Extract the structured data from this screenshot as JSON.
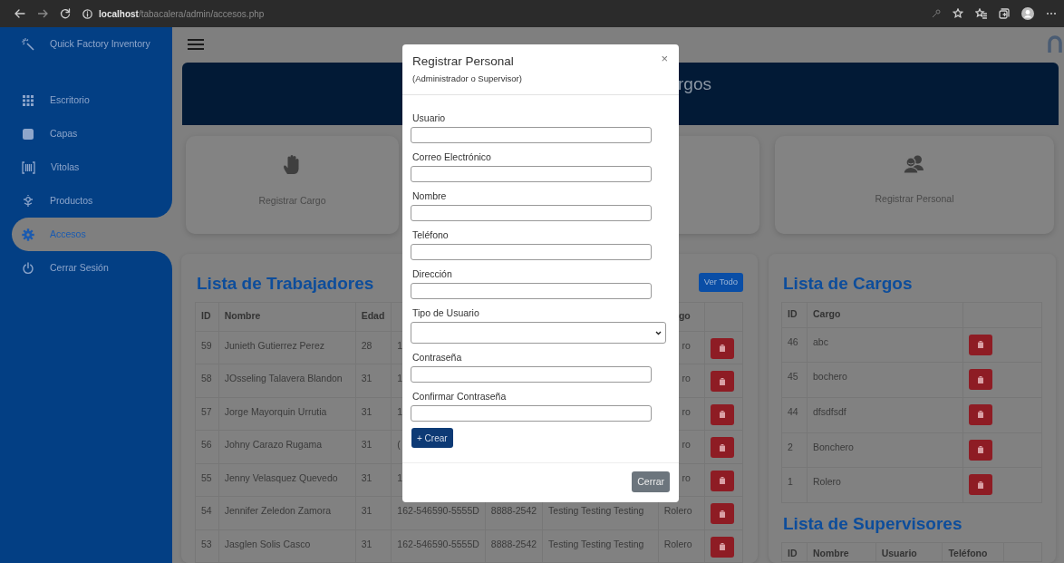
{
  "browser": {
    "url": "**localhost**/tabacalera/admin/accesos.php"
  },
  "sidebar": {
    "brand": "Quick Factory Inventory",
    "items": [
      {
        "label": "Escritorio",
        "selected": false
      },
      {
        "label": "Capas",
        "selected": false
      },
      {
        "label": "Vitolas",
        "selected": false
      },
      {
        "label": "Productos",
        "selected": false
      },
      {
        "label": "Accesos",
        "selected": true
      },
      {
        "label": "Cerrar Sesión",
        "selected": false
      }
    ]
  },
  "banner": {
    "title": "rgos"
  },
  "action_cards": [
    {
      "kind": "action",
      "label": "Registrar Cargo"
    },
    {
      "kind": "covered"
    },
    {
      "kind": "action",
      "label": "Registrar Personal"
    }
  ],
  "workers": {
    "title": "Lista de Trabajadores",
    "button": "Ver Todo",
    "columns": [
      "ID",
      "Nombre",
      "Edad",
      null,
      null,
      null,
      "go"
    ],
    "rows": [
      {
        "cells": [
          "59",
          "Junieth Gutierrez Perez",
          "28",
          "1",
          null,
          null,
          "ro"
        ]
      },
      {
        "cells": [
          "58",
          "JOsseling Talavera Blandon",
          "31",
          "1",
          null,
          null,
          "ro"
        ]
      },
      {
        "cells": [
          "57",
          "Jorge Mayorquin Urrutia",
          "31",
          "1",
          null,
          null,
          "ro"
        ]
      },
      {
        "cells": [
          "56",
          "Johny Carazo Rugama",
          "31",
          "(",
          null,
          null,
          "ro"
        ]
      },
      {
        "cells": [
          "55",
          "Jenny Velasquez Quevedo",
          "31",
          "1",
          null,
          null,
          "ro"
        ]
      },
      {
        "cells": [
          "54",
          "Jennifer Zeledon Zamora",
          "31",
          "162-546590-5555D",
          "8888-2542",
          "Testing Testing Testing",
          "Rolero"
        ]
      },
      {
        "cells": [
          "53",
          "Jasglen Solis Casco",
          "31",
          "162-546590-5555D",
          "8888-2542",
          "Testing Testing Testing",
          "Rolero"
        ]
      }
    ]
  },
  "cargos": {
    "title": "Lista de Cargos",
    "columns": [
      "ID",
      "Cargo"
    ],
    "rows": [
      [
        "46",
        "abc"
      ],
      [
        "45",
        "bochero"
      ],
      [
        "44",
        "dfsdfsdf"
      ],
      [
        "2",
        "Bonchero"
      ],
      [
        "1",
        "Rolero"
      ]
    ]
  },
  "supervisors": {
    "title": "Lista de Supervisores",
    "columns": [
      "ID",
      "Nombre",
      "Usuario",
      "Teléfono"
    ]
  },
  "modal": {
    "title": "Registrar Personal",
    "subtitle": "(Administrador o Supervisor)",
    "close": "×",
    "fields": [
      {
        "label": "Usuario",
        "kind": "text"
      },
      {
        "label": "Correo Electrónico",
        "kind": "text"
      },
      {
        "label": "Nombre",
        "kind": "text"
      },
      {
        "label": "Teléfono",
        "kind": "text"
      },
      {
        "label": "Dirección",
        "kind": "text"
      },
      {
        "label": "Tipo de Usuario",
        "kind": "select"
      },
      {
        "label": "Contraseña",
        "kind": "text"
      },
      {
        "label": "Confirmar Contraseña",
        "kind": "text"
      }
    ],
    "submit": "+ Crear",
    "dismiss": "Cerrar"
  }
}
